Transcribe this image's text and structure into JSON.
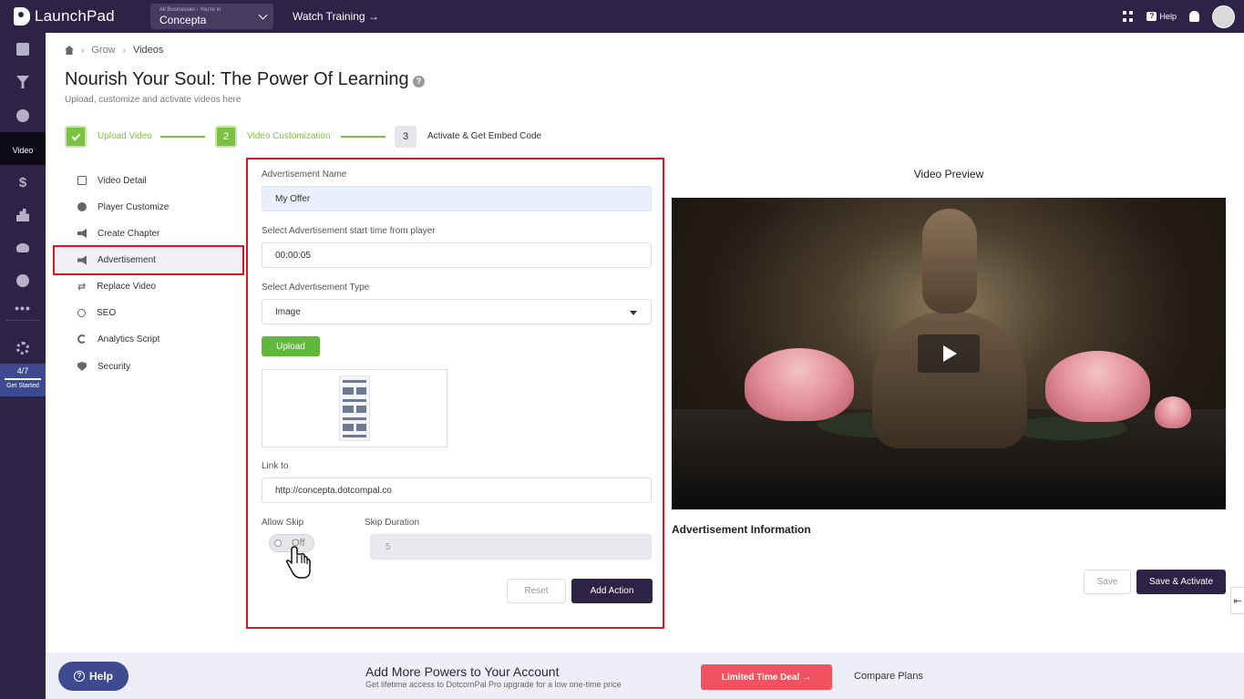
{
  "app": {
    "logo": "LaunchPad",
    "business_crumb": "All Businesses › You're In",
    "business_name": "Concepta",
    "watch_training": "Watch Training →",
    "help": "Help"
  },
  "sidebar": {
    "active_label": "Video",
    "progress": "4/7",
    "progress_fraction": 0.57,
    "progress_label": "Get Started"
  },
  "breadcrumb": [
    "Grow",
    "Videos"
  ],
  "page": {
    "title": "Nourish Your Soul: The Power Of Learning",
    "subtitle": "Upload, customize and activate videos here"
  },
  "stepper": {
    "steps": [
      {
        "number": "1",
        "label": "Upload Video",
        "state": "done"
      },
      {
        "number": "2",
        "label": "Video Customization",
        "state": "current"
      },
      {
        "number": "3",
        "label": "Activate & Get Embed Code",
        "state": "todo"
      }
    ]
  },
  "menu": {
    "items": [
      {
        "label": "Video Detail",
        "icon": "edit-icon"
      },
      {
        "label": "Player Customize",
        "icon": "palette-icon"
      },
      {
        "label": "Create Chapter",
        "icon": "megaphone-icon"
      },
      {
        "label": "Advertisement",
        "icon": "megaphone-icon",
        "active": true
      },
      {
        "label": "Replace Video",
        "icon": "swap-icon"
      },
      {
        "label": "SEO",
        "icon": "search-icon"
      },
      {
        "label": "Analytics Script",
        "icon": "chart-icon"
      },
      {
        "label": "Security",
        "icon": "shield-icon"
      }
    ]
  },
  "form": {
    "ad_name_label": "Advertisement Name",
    "ad_name_value": "My Offer",
    "start_time_label": "Select Advertisement start time from player",
    "start_time_value": "00:00:05",
    "type_label": "Select Advertisement Type",
    "type_value": "Image",
    "upload_label": "Upload",
    "link_label": "Link to",
    "link_value": "http://concepta.dotcompal.co",
    "allow_skip_label": "Allow Skip",
    "allow_skip_state": "Off",
    "skip_duration_label": "Skip Duration",
    "skip_duration_value": "5",
    "reset_label": "Reset",
    "add_action_label": "Add Action"
  },
  "preview": {
    "title": "Video Preview",
    "ad_info_title": "Advertisement Information",
    "save_label": "Save",
    "save_activate_label": "Save & Activate",
    "edge_handle": "⇤"
  },
  "banner": {
    "help_label": "Help",
    "title": "Add More Powers to Your Account",
    "subtitle": "Get lifetime access to DotcomPal Pro upgrade for a low one-time price",
    "deal_label": "Limited Time Deal →",
    "compare_label": "Compare Plans"
  },
  "colors": {
    "brand_dark": "#2d2346",
    "accent_green": "#7cc242",
    "highlight_red": "#e0141e",
    "deal_red": "#f0525f"
  }
}
